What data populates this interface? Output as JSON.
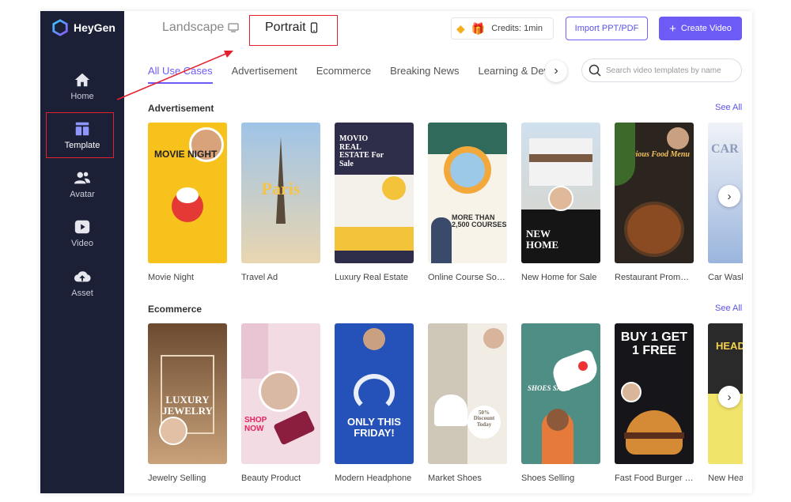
{
  "brand": {
    "name": "HeyGen"
  },
  "sidebar": {
    "items": [
      {
        "label": "Home",
        "icon": "home-icon"
      },
      {
        "label": "Template",
        "icon": "template-icon"
      },
      {
        "label": "Avatar",
        "icon": "avatar-icon"
      },
      {
        "label": "Video",
        "icon": "video-icon"
      },
      {
        "label": "Asset",
        "icon": "asset-icon"
      }
    ]
  },
  "topbar": {
    "landscape": "Landscape",
    "portrait": "Portrait",
    "credits": "Credits: 1min",
    "import": "Import PPT/PDF",
    "create": "Create Video"
  },
  "tabs": [
    "All Use Cases",
    "Advertisement",
    "Ecommerce",
    "Breaking News",
    "Learning & Development"
  ],
  "search": {
    "placeholder": "Search video templates by name"
  },
  "sections": [
    {
      "title": "Advertisement",
      "see_all": "See All",
      "cards": [
        {
          "caption": "Movie Night",
          "overlay": "MOVIE NIGHT"
        },
        {
          "caption": "Travel Ad",
          "overlay": "Paris"
        },
        {
          "caption": "Luxury Real Estate",
          "overlay": "MOVIO REAL ESTATE For Sale"
        },
        {
          "caption": "Online Course Software",
          "overlay": "MORE THAN 2,500 COURSES"
        },
        {
          "caption": "New Home for Sale",
          "overlay": "NEW HOME"
        },
        {
          "caption": "Restaurant Promotion",
          "overlay": "Delicious Food Menu"
        },
        {
          "caption": "Car Wash",
          "overlay": "CAR"
        }
      ]
    },
    {
      "title": "Ecommerce",
      "see_all": "See All",
      "cards": [
        {
          "caption": "Jewelry Selling",
          "overlay": "LUXURY JEWELRY"
        },
        {
          "caption": "Beauty Product",
          "overlay": "SHOP NOW"
        },
        {
          "caption": "Modern Headphone",
          "overlay": "ONLY THIS FRIDAY!"
        },
        {
          "caption": "Market Shoes",
          "overlay": "50% Discount Today"
        },
        {
          "caption": "Shoes Selling",
          "overlay": "SHOES SALE"
        },
        {
          "caption": "Fast Food Burger Promotion",
          "overlay": "BUY 1 GET 1 FREE"
        },
        {
          "caption": "New Headphone",
          "overlay": "HEAD"
        }
      ]
    }
  ],
  "colors": {
    "accent": "#6c5cf5",
    "sidebar": "#1c2036",
    "annotation": "#e5202e"
  }
}
